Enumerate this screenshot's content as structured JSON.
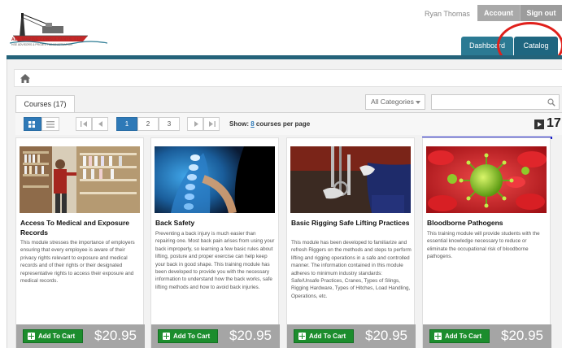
{
  "header": {
    "logo_name": "AES MARINE CONSULTANTS, LLC",
    "logo_tagline": "HSE ADVISORS & PROJECT ADMINISTRATION",
    "user_name": "Ryan Thomas",
    "account_label": "Account",
    "signout_label": "Sign out",
    "tabs": [
      {
        "label": "Dashboard",
        "active": false
      },
      {
        "label": "Catalog",
        "active": true
      }
    ],
    "annotation_color": "#e0201b"
  },
  "catalog": {
    "courses_tab_label": "Courses",
    "courses_count": "(17)",
    "category_select": "All Categories",
    "search_placeholder": "",
    "pagination": {
      "pages": [
        "1",
        "2",
        "3"
      ],
      "current_page": "1"
    },
    "show_prefix": "Show:",
    "show_count": "8",
    "show_suffix": "courses per page",
    "total_count": "17"
  },
  "cards": [
    {
      "title": "Access To Medical and Exposure Records",
      "description": "This module stresses the importance of employers ensuring that every employee is aware of their privacy rights relevant to exposure and medical records and of their rights or their designated representative rights to access their exposure and medical records.",
      "add_label": "Add To Cart",
      "price": "$20.95"
    },
    {
      "title": "Back Safety",
      "description": "Preventing a back injury is much easier than repairing one. Most back pain arises from using your back improperly, so learning a few basic rules about lifting, posture and proper exercise can help keep your back in good shape. This training module has been developed to provide you with the necessary information to understand how the back works, safe lifting methods and how to avoid back injuries.",
      "add_label": "Add To Cart",
      "price": "$20.95"
    },
    {
      "title": "Basic Rigging Safe Lifting Practices",
      "description": "This module has been developed to familiarize and refresh Riggers on the methods and steps to perform lifting and rigging operations in a safe and controlled manner. The information contained in this module adheres to minimum industry standards: Safe/Unsafe Practices, Cranes, Types of Slings, Rigging Hardware, Types of Hitches, Load Handling, Operations, etc.",
      "add_label": "Add To Cart",
      "price": "$20.95"
    },
    {
      "title": "Bloodborne Pathogens",
      "description": "This training module will provide students with the essential knowledge necessary to reduce or eliminate the occupational risk of bloodborne pathogens.",
      "add_label": "Add To Cart",
      "price": "$20.95"
    }
  ]
}
